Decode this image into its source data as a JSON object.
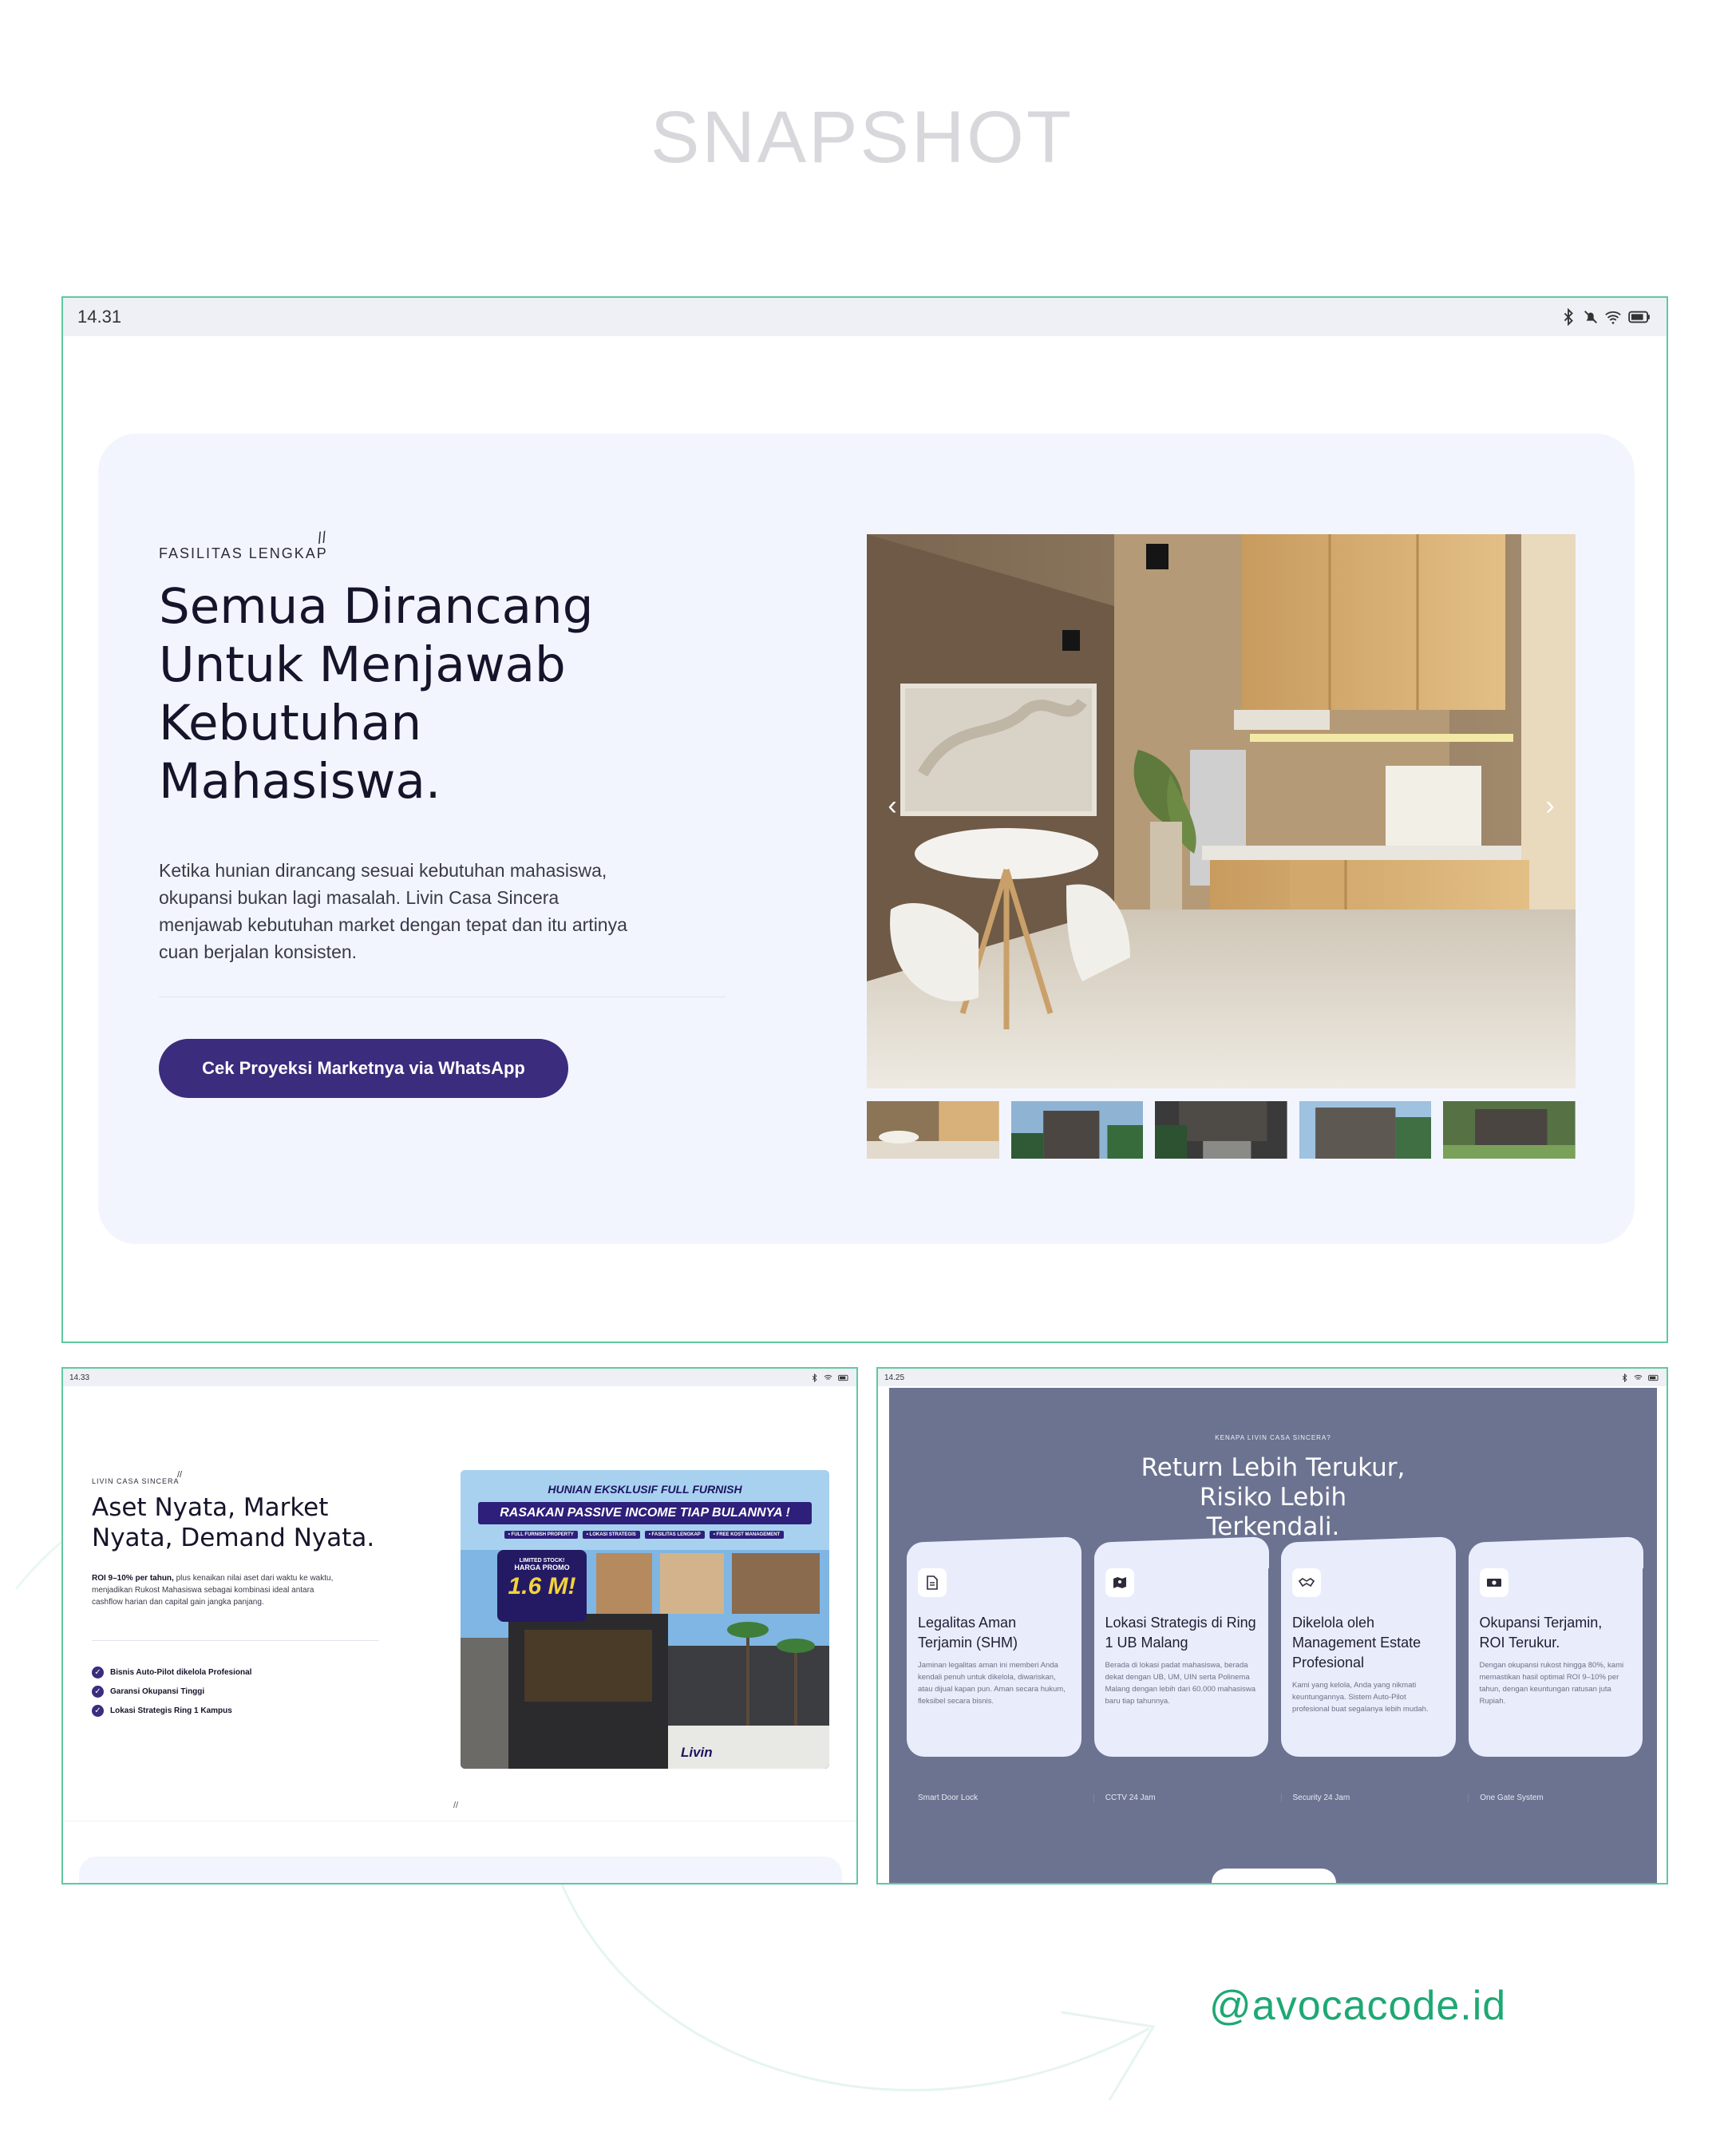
{
  "snapshot_title": "SNAPSHOT",
  "handle": "@avocacode.id",
  "screen1": {
    "time": "14.31",
    "eyebrow": "FASILITAS LENGKAP",
    "headline": "Semua Dirancang Untuk Menjawab Kebutuhan Mahasiswa.",
    "paragraph": "Ketika hunian dirancang sesuai kebutuhan mahasiswa, okupansi bukan lagi masalah. Livin Casa Sincera menjawab kebutuhan market dengan tepat dan itu artinya cuan berjalan konsisten.",
    "cta": "Cek Proyeksi Marketnya via WhatsApp",
    "prev_icon": "chevron-left-icon",
    "next_icon": "chevron-right-icon"
  },
  "screen2": {
    "time": "14.33",
    "eyebrow": "LIVIN CASA SINCERA",
    "headline": "Aset Nyata, Market Nyata, Demand Nyata.",
    "para_bold": "ROI 9–10% per tahun,",
    "para_rest": " plus kenaikan nilai aset dari waktu ke waktu, menjadikan Rukost Mahasiswa sebagai kombinasi ideal antara cashflow harian dan capital gain jangka panjang.",
    "benefits": [
      "Bisnis Auto-Pilot dikelola Profesional",
      "Garansi Okupansi Tinggi",
      "Lokasi Strategis Ring 1 Kampus"
    ],
    "banner": {
      "line1": "HUNIAN EKSKLUSIF FULL FURNISH",
      "line2": "RASAKAN PASSIVE INCOME TIAP BULANNYA !",
      "tags": [
        "• FULL FURNISH PROPERTY",
        "• LOKASI STRATEGIS",
        "• FASILITAS LENGKAP",
        "• FREE KOST MANAGEMENT"
      ],
      "promo_small": "LIMITED STOCK!",
      "promo_label": "HARGA PROMO",
      "promo_price": "1.6 M!",
      "brand": "Livin"
    }
  },
  "screen3": {
    "time": "14.25",
    "eyebrow": "KENAPA LIVIN CASA SINCERA?",
    "headline": "Return Lebih Terukur, Risiko Lebih Terkendali.",
    "cards": [
      {
        "icon": "document-icon",
        "title": "Legalitas Aman Terjamin (SHM)",
        "body": "Jaminan legalitas aman ini memberi Anda kendali penuh untuk dikelola, diwariskan, atau dijual kapan pun. Aman secara hukum, fleksibel secara bisnis."
      },
      {
        "icon": "map-icon",
        "title": "Lokasi Strategis di Ring 1 UB Malang",
        "body": "Berada di lokasi padat mahasiswa, berada dekat dengan UB, UM, UIN serta Polinema Malang dengan lebih dari 60.000 mahasiswa baru tiap tahunnya."
      },
      {
        "icon": "handshake-icon",
        "title": "Dikelola oleh Management Estate Profesional",
        "body": "Kami yang kelola, Anda yang nikmati keuntungannya. Sistem Auto-Pilot profesional buat segalanya lebih mudah."
      },
      {
        "icon": "money-icon",
        "title": "Okupansi Terjamin, ROI Terukur.",
        "body": "Dengan okupansi rukost hingga 80%, kami memastikan hasil optimal ROI 9–10% per tahun, dengan keuntungan ratusan juta Rupiah."
      }
    ],
    "features": [
      "Smart Door Lock",
      "CCTV 24 Jam",
      "Security 24 Jam",
      "One Gate System"
    ]
  },
  "colors": {
    "frame_border": "#5fc9a0",
    "primary_button": "#3b2c7d",
    "card_bg": "#f2f5fd",
    "panel_bg": "#6c7391",
    "handle": "#1fa874"
  }
}
